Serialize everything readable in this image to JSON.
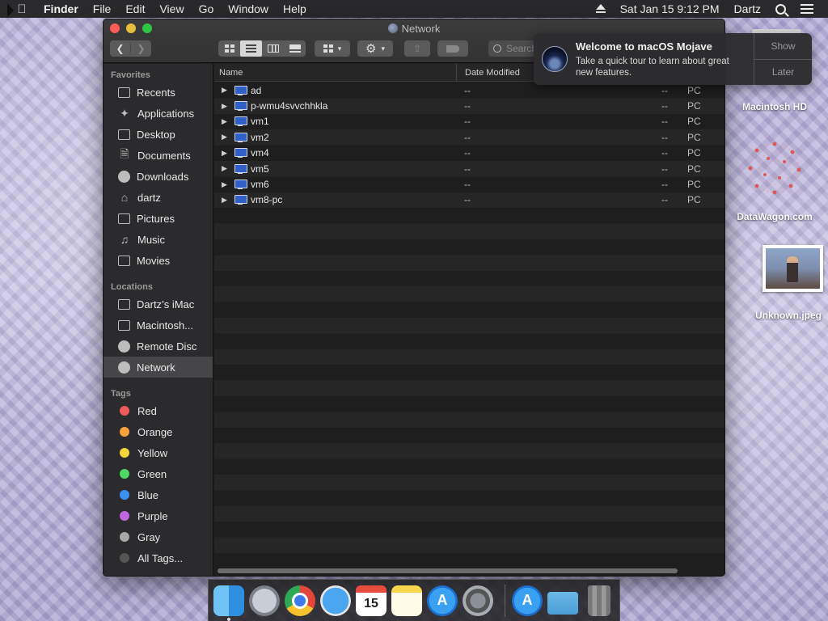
{
  "menubar": {
    "apple": "",
    "app_name": "Finder",
    "items": [
      "File",
      "Edit",
      "View",
      "Go",
      "Window",
      "Help"
    ],
    "datetime": "Sat Jan 15  9:12 PM",
    "user": "Dartz"
  },
  "window": {
    "title": "Network",
    "search_placeholder": "Search",
    "columns": {
      "name": "Name",
      "date": "Date Modified"
    }
  },
  "sidebar": {
    "favorites_heading": "Favorites",
    "favorites": [
      {
        "label": "Recents"
      },
      {
        "label": "Applications"
      },
      {
        "label": "Desktop"
      },
      {
        "label": "Documents"
      },
      {
        "label": "Downloads"
      },
      {
        "label": "dartz"
      },
      {
        "label": "Pictures"
      },
      {
        "label": "Music"
      },
      {
        "label": "Movies"
      }
    ],
    "locations_heading": "Locations",
    "locations": [
      {
        "label": "Dartz’s iMac"
      },
      {
        "label": "Macintosh..."
      },
      {
        "label": "Remote Disc"
      },
      {
        "label": "Network"
      }
    ],
    "tags_heading": "Tags",
    "tags": [
      {
        "label": "Red",
        "color": "#f05a5a"
      },
      {
        "label": "Orange",
        "color": "#f7a23a"
      },
      {
        "label": "Yellow",
        "color": "#f5d63a"
      },
      {
        "label": "Green",
        "color": "#4cd964"
      },
      {
        "label": "Blue",
        "color": "#3d8ff0"
      },
      {
        "label": "Purple",
        "color": "#c067e0"
      },
      {
        "label": "Gray",
        "color": "#a7a7a7"
      }
    ],
    "all_tags": "All Tags..."
  },
  "rows": [
    {
      "name": "ad",
      "date": "--",
      "size": "--",
      "kind": "PC"
    },
    {
      "name": "p-wmu4svvchhkla",
      "date": "--",
      "size": "--",
      "kind": "PC"
    },
    {
      "name": "vm1",
      "date": "--",
      "size": "--",
      "kind": "PC"
    },
    {
      "name": "vm2",
      "date": "--",
      "size": "--",
      "kind": "PC"
    },
    {
      "name": "vm4",
      "date": "--",
      "size": "--",
      "kind": "PC"
    },
    {
      "name": "vm5",
      "date": "--",
      "size": "--",
      "kind": "PC"
    },
    {
      "name": "vm6",
      "date": "--",
      "size": "--",
      "kind": "PC"
    },
    {
      "name": "vm8-pc",
      "date": "--",
      "size": "--",
      "kind": "PC"
    }
  ],
  "notification": {
    "title": "Welcome to macOS Mojave",
    "body": "Take a quick tour to learn about great new features.",
    "show": "Show",
    "later": "Later"
  },
  "desktop": {
    "hd_label": "Macintosh HD",
    "datawagon_label": "DataWagon.com",
    "image_label": "Unknown.jpeg"
  },
  "dock": {
    "calendar_month": "JAN",
    "calendar_day": "15"
  }
}
